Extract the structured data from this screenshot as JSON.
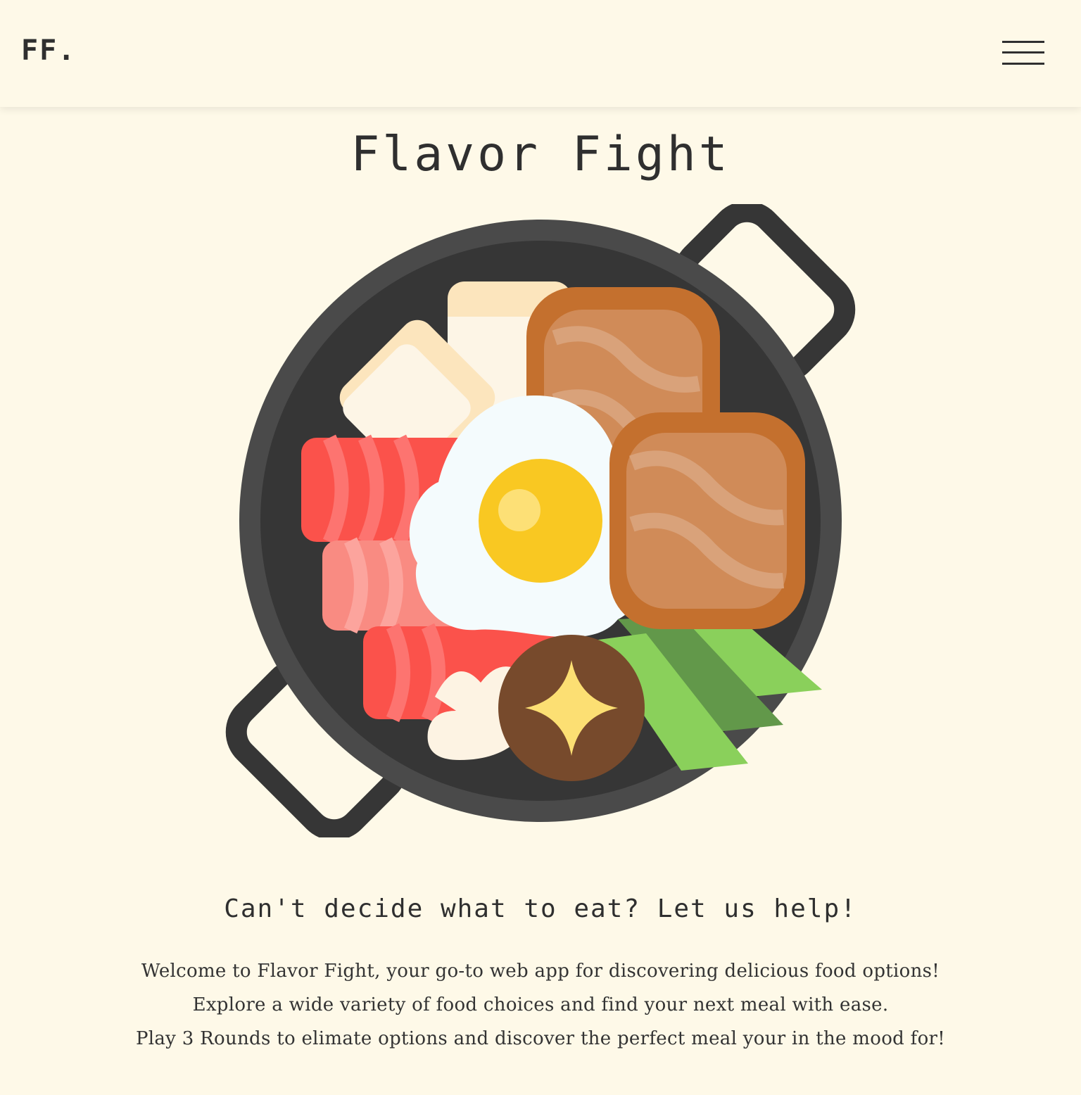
{
  "header": {
    "logo_text": "FF.",
    "menu_icon": "hamburger-menu-icon"
  },
  "hero": {
    "title": "Flavor Fight",
    "illustration_icon": "hot-pot-food-icon",
    "subtitle": "Can't decide what to eat? Let us help!",
    "paragraphs": [
      "Welcome to Flavor Fight, your go-to web app for discovering delicious food options!",
      "Explore a wide variety of food choices and find your next meal with ease.",
      "Play 3 Rounds to elimate options and discover the perfect meal your in the mood for!"
    ]
  },
  "colors": {
    "background": "#fef9e8",
    "text": "#333333",
    "pan": "#363636",
    "pan_rim": "#4a4a4a"
  }
}
